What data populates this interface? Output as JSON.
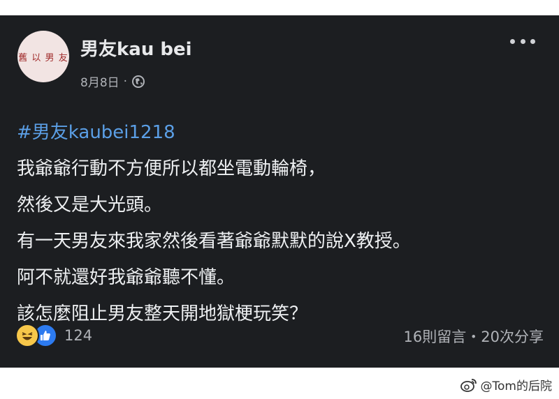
{
  "post": {
    "author": "男友kau bei",
    "avatar_text": "舊 以 男 友",
    "date": "8月8日",
    "separator": "·",
    "hashtag": "#男友kaubei1218",
    "lines": [
      "我爺爺行動不方便所以都坐電動輪椅，",
      "然後又是大光頭。",
      "有一天男友來我家然後看著爺爺默默的說X教授。",
      "阿不就還好我爺爺聽不懂。",
      "該怎麼阻止男友整天開地獄梗玩笑？"
    ],
    "reaction_count": "124",
    "stats": "16則留言・20次分享"
  },
  "watermark": {
    "text": "@Tom的后院"
  },
  "colors": {
    "card_bg": "#1c1e21",
    "hashtag": "#5b9fe6",
    "muted": "#b0b3b8"
  }
}
